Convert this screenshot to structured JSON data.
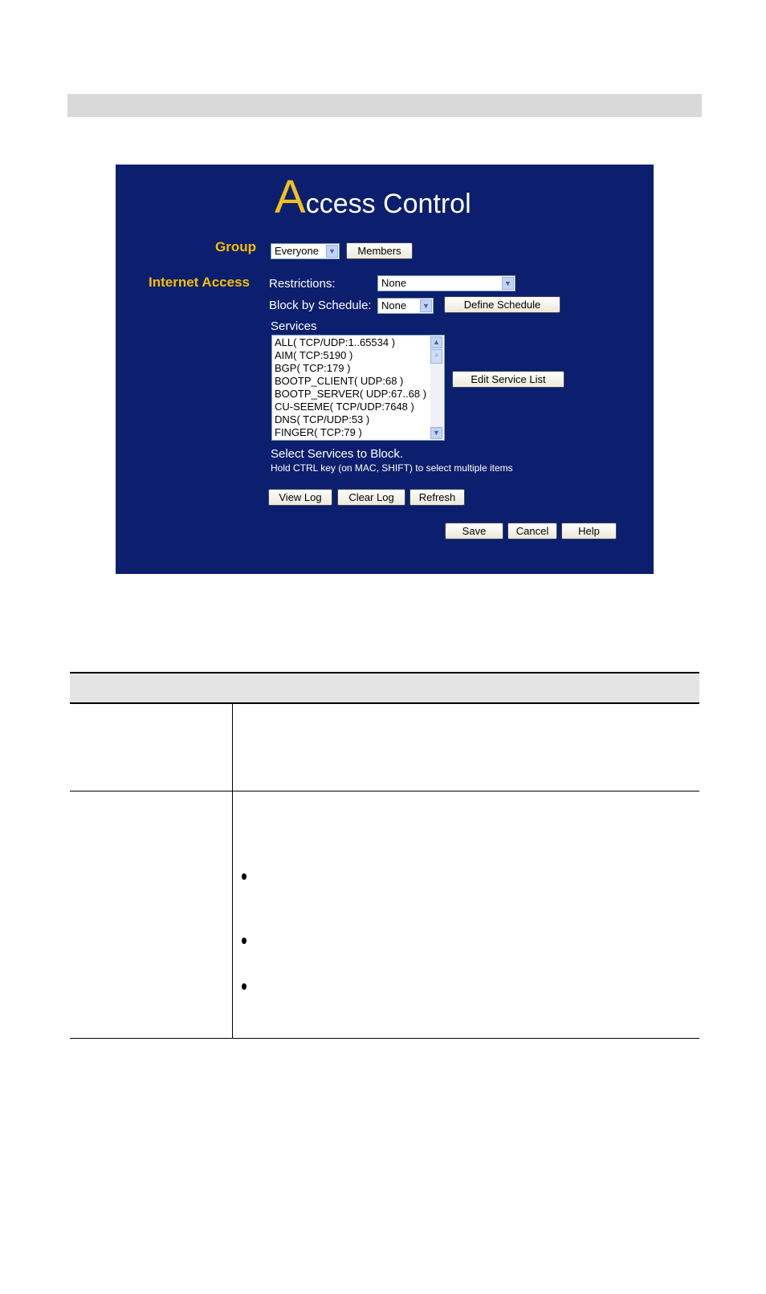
{
  "page": {
    "top_bar": ""
  },
  "access_control": {
    "title_initial": "A",
    "title_rest": "ccess Control",
    "group": {
      "label": "Group",
      "select_value": "Everyone",
      "members_button": "Members"
    },
    "internet_access": {
      "label": "Internet Access",
      "restrictions_label": "Restrictions:",
      "restrictions_value": "None",
      "schedule_label": "Block by Schedule:",
      "schedule_value": "None",
      "define_schedule_button": "Define Schedule",
      "services_label": "Services",
      "services": [
        "ALL( TCP/UDP:1..65534 )",
        "AIM( TCP:5190 )",
        "BGP( TCP:179 )",
        "BOOTP_CLIENT( UDP:68 )",
        "BOOTP_SERVER( UDP:67..68 )",
        "CU-SEEME( TCP/UDP:7648 )",
        "DNS( TCP/UDP:53 )",
        "FINGER( TCP:79 )"
      ],
      "edit_service_list_button": "Edit Service List",
      "hint_main": "Select Services to Block.",
      "hint_sub": "Hold CTRL key (on MAC, SHIFT) to select multiple items"
    },
    "log_buttons": {
      "view_log": "View Log",
      "clear_log": "Clear Log",
      "refresh": "Refresh"
    },
    "footer_buttons": {
      "save": "Save",
      "cancel": "Cancel",
      "help": "Help"
    }
  },
  "table": {
    "rows": 2,
    "bullets_in_row_2": 3
  }
}
